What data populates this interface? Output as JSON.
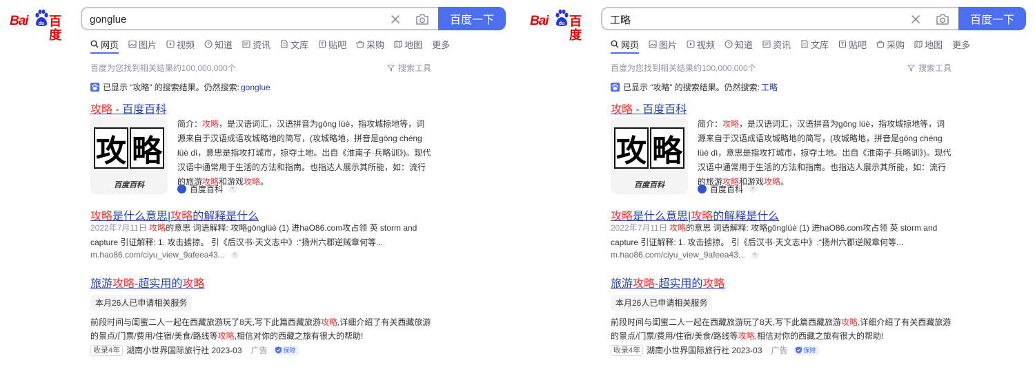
{
  "brand": {
    "logo_latin": "Bai",
    "logo_hanzi": "百度"
  },
  "panels": [
    {
      "query": "gonglue",
      "search_button": "百度一下",
      "tabs": [
        "网页",
        "图片",
        "视频",
        "知道",
        "资讯",
        "文库",
        "贴吧",
        "采购",
        "地图",
        "更多"
      ],
      "active_tab": "网页",
      "result_count": "百度为您找到相关结果约100,000,000个",
      "tools_label": "搜索工具",
      "correction": {
        "prefix": "已显示 “攻略” 的搜索结果。仍然搜索: ",
        "link": "gonglue"
      },
      "results": [
        {
          "title_hl": "攻略",
          "title_rest": " - 百度百科",
          "thumb_text": "攻略",
          "thumb_watermark": "百度百科",
          "abs_1": "简介：",
          "abs_hl1": "攻略",
          "abs_2": "，是汉语词汇，汉语拼音为gōng lüè，指攻城掠地等，词源来自于汉语成语攻城略地的简写，(攻城略地，拼音是gōng chéng lüè dì，意思是指攻打城市，掠夺土地。出自《淮南子·兵略训》)。现代汉语中通常用于生活的方法和指南。也指达人展示其所能，如：流行的旅游",
          "abs_hl2": "攻略",
          "abs_3": "和游戏",
          "abs_hl3": "攻略",
          "abs_4": "。",
          "source": "百度百科"
        },
        {
          "title_hl": "攻略",
          "title_mid": "是什么意思|",
          "title_hl2": "攻略",
          "title_rest": "的解释是什么",
          "date": "2022年7月11日",
          "text_hl": "攻略",
          "text": "的意思 词语解释: 攻略gōnglüè (1) 进haO86.com攻占领 英 storm and capture 引证解释: 1. 攻击掳掠。 引《后汉书·天文志中》:“扬州六郡逆贼章何等...",
          "url": "m.hao86.com/ciyu_view_9afeea43..."
        },
        {
          "title_1": "旅游",
          "title_hl": "攻略",
          "title_2": "-超实用的",
          "title_hl2": "攻略",
          "tag": "本月26人已申请相关服务",
          "desc_1": "前段时间与闺蜜二人一起在西藏旅游玩了8天,写下此篇西藏旅游",
          "desc_hl1": "攻略",
          "desc_2": ",详细介绍了有关西藏旅游的景点/门票/费用/住宿/美食/路线等",
          "desc_hl2": "攻略",
          "desc_3": ",相信对你的西藏之旅有很大的帮助!",
          "badge": "收录4年",
          "advertiser": "湖南小世界国际旅行社 2023-03",
          "ad_label": "广告",
          "guarantee": "保障"
        }
      ]
    },
    {
      "query": "工略",
      "search_button": "百度一下",
      "tabs": [
        "网页",
        "图片",
        "视频",
        "知道",
        "资讯",
        "文库",
        "贴吧",
        "采购",
        "地图",
        "更多"
      ],
      "active_tab": "网页",
      "result_count": "百度为您找到相关结果约100,000,000个",
      "tools_label": "搜索工具",
      "correction": {
        "prefix": "已显示 “攻略” 的搜索结果。仍然搜索: ",
        "link": "工略"
      },
      "results": [
        {
          "title_hl": "攻略",
          "title_rest": " - 百度百科",
          "thumb_text": "攻略",
          "thumb_watermark": "百度百科",
          "abs_1": "简介：",
          "abs_hl1": "攻略",
          "abs_2": "，是汉语词汇，汉语拼音为gōng lüè，指攻城掠地等，词源来自于汉语成语攻城略地的简写，(攻城略地，拼音是gōng chéng lüè dì，意思是指攻打城市，掠夺土地。出自《淮南子·兵略训》)。现代汉语中通常用于生活的方法和指南。也指达人展示其所能，如：流行的旅游",
          "abs_hl2": "攻略",
          "abs_3": "和游戏",
          "abs_hl3": "攻略",
          "abs_4": "。",
          "source": "百度百科"
        },
        {
          "title_hl": "攻略",
          "title_mid": "是什么意思|",
          "title_hl2": "攻略",
          "title_rest": "的解释是什么",
          "date": "2022年7月11日",
          "text_hl": "攻略",
          "text": "的意思 词语解释: 攻略gōnglüè (1) 进haO86.com攻占领 英 storm and capture 引证解释: 1. 攻击掳掠。 引《后汉书·天文志中》:“扬州六郡逆贼章何等...",
          "url": "m.hao86.com/ciyu_view_9afeea43..."
        },
        {
          "title_1": "旅游",
          "title_hl": "攻略",
          "title_2": "-超实用的",
          "title_hl2": "攻略",
          "tag": "本月26人已申请相关服务",
          "desc_1": "前段时间与闺蜜二人一起在西藏旅游玩了8天,写下此篇西藏旅游",
          "desc_hl1": "攻略",
          "desc_2": ",详细介绍了有关西藏旅游的景点/门票/费用/住宿/美食/路线等",
          "desc_hl2": "攻略",
          "desc_3": ",相信对你的西藏之旅有很大的帮助!",
          "badge": "收录4年",
          "advertiser": "湖南小世界国际旅行社 2023-03",
          "ad_label": "广告",
          "guarantee": "保障"
        }
      ]
    }
  ]
}
